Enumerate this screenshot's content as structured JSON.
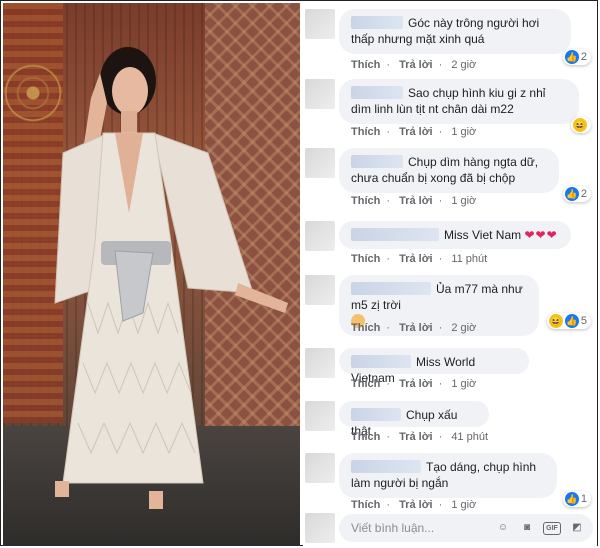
{
  "composer": {
    "placeholder": "Viết bình luận...",
    "icons": [
      "emoji-icon",
      "camera-icon",
      "gif-icon",
      "sticker-icon"
    ],
    "gif_label": "GIF"
  },
  "actions": {
    "like": "Thích",
    "reply": "Trả lời"
  },
  "comments": [
    {
      "text": "Góc này trông người hơi thấp nhưng mặt xinh quá",
      "time": "2 giờ",
      "reactions": [
        "like"
      ],
      "count": "2"
    },
    {
      "text": "Sao chụp hình kiu gi z nhỉ dìm linh lùn tịt nt chân dài m22",
      "time": "1 giờ",
      "reactions": [
        "haha"
      ],
      "count": ""
    },
    {
      "text": "Chụp dìm hàng ngta dữ, chưa chuẩn bị xong đã bị chộp",
      "time": "1 giờ",
      "reactions": [
        "like"
      ],
      "count": "2"
    },
    {
      "text": "Miss Viet Nam",
      "suffix": "❤❤❤",
      "time": "11 phút",
      "reactions": [],
      "count": ""
    },
    {
      "text": "Ủa m77 mà như m5 zị trời",
      "time": "2 giờ",
      "reactions": [
        "haha",
        "like"
      ],
      "count": "5"
    },
    {
      "text": "Miss World Vietnam",
      "time": "1 giờ",
      "reactions": [],
      "count": ""
    },
    {
      "text": "Chụp xấu thật",
      "time": "41 phút",
      "reactions": [],
      "count": ""
    },
    {
      "text": "Tạo dáng, chụp hình làm người bị ngắn",
      "time": "1 giờ",
      "reactions": [
        "like"
      ],
      "count": "1"
    }
  ],
  "colors": {
    "bubble": "#f0f2f5",
    "like": "#1877f2",
    "haha": "#f7c21a",
    "meta": "#65676b"
  }
}
